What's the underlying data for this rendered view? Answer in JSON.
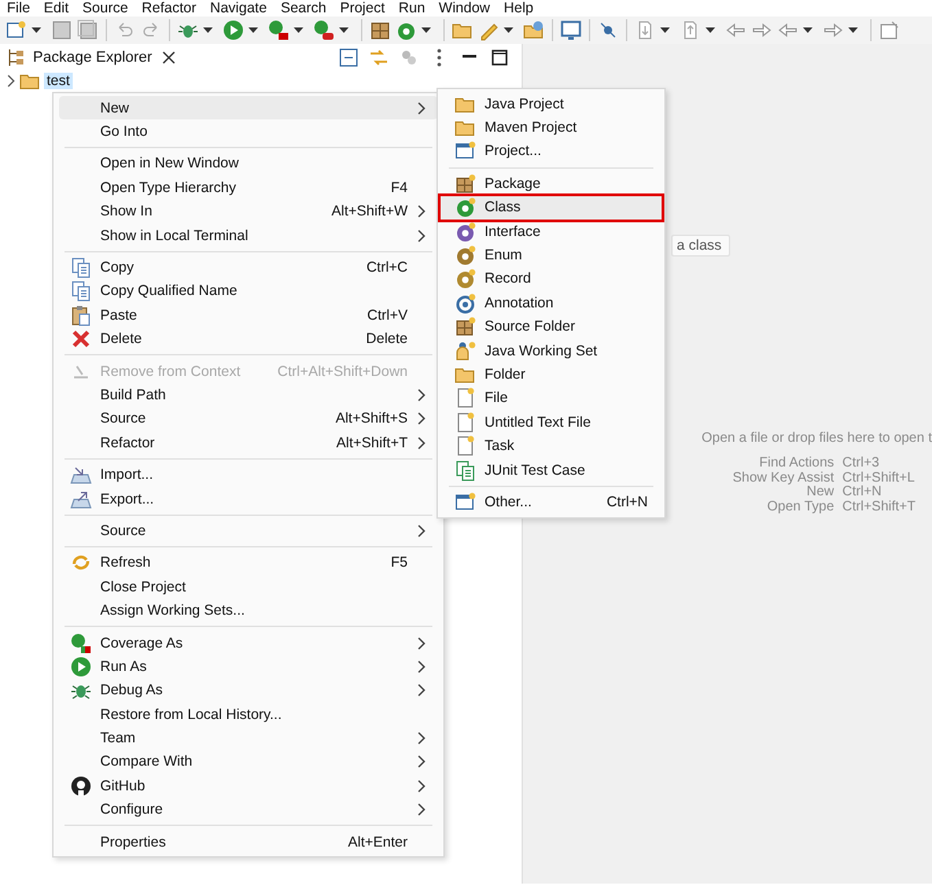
{
  "menubar": [
    "File",
    "Edit",
    "Source",
    "Refactor",
    "Navigate",
    "Search",
    "Project",
    "Run",
    "Window",
    "Help"
  ],
  "view_tab": {
    "title": "Package Explorer"
  },
  "tree": [
    {
      "label": "test",
      "selected": true,
      "expanded": false
    }
  ],
  "context_menu": [
    {
      "kind": "item",
      "label": "New",
      "selected": true,
      "disabled": false,
      "submenu": true
    },
    {
      "kind": "item",
      "label": "Go Into",
      "selected": false,
      "disabled": false,
      "submenu": false
    },
    {
      "kind": "separator"
    },
    {
      "kind": "item",
      "label": "Open in New Window",
      "selected": false,
      "disabled": false,
      "submenu": false
    },
    {
      "kind": "item",
      "label": "Open Type Hierarchy",
      "shortcut": "F4",
      "selected": false,
      "disabled": false,
      "submenu": false
    },
    {
      "kind": "item",
      "label": "Show In",
      "shortcut": "Alt+Shift+W",
      "selected": false,
      "disabled": false,
      "submenu": true
    },
    {
      "kind": "item",
      "label": "Show in Local Terminal",
      "selected": false,
      "disabled": false,
      "submenu": true
    },
    {
      "kind": "separator"
    },
    {
      "kind": "item",
      "label": "Copy",
      "shortcut": "Ctrl+C",
      "selected": false,
      "disabled": false,
      "submenu": false
    },
    {
      "kind": "item",
      "label": "Copy Qualified Name",
      "selected": false,
      "disabled": false,
      "submenu": false
    },
    {
      "kind": "item",
      "label": "Paste",
      "shortcut": "Ctrl+V",
      "selected": false,
      "disabled": false,
      "submenu": false
    },
    {
      "kind": "item",
      "label": "Delete",
      "shortcut": "Delete",
      "selected": false,
      "disabled": false,
      "submenu": false
    },
    {
      "kind": "separator"
    },
    {
      "kind": "item",
      "label": "Remove from Context",
      "shortcut": "Ctrl+Alt+Shift+Down",
      "selected": false,
      "disabled": true,
      "submenu": false
    },
    {
      "kind": "item",
      "label": "Build Path",
      "selected": false,
      "disabled": false,
      "submenu": true
    },
    {
      "kind": "item",
      "label": "Source",
      "shortcut": "Alt+Shift+S",
      "selected": false,
      "disabled": false,
      "submenu": true
    },
    {
      "kind": "item",
      "label": "Refactor",
      "shortcut": "Alt+Shift+T",
      "selected": false,
      "disabled": false,
      "submenu": true
    },
    {
      "kind": "separator"
    },
    {
      "kind": "item",
      "label": "Import...",
      "selected": false,
      "disabled": false,
      "submenu": false
    },
    {
      "kind": "item",
      "label": "Export...",
      "selected": false,
      "disabled": false,
      "submenu": false
    },
    {
      "kind": "separator"
    },
    {
      "kind": "item",
      "label": "Source",
      "selected": false,
      "disabled": false,
      "submenu": true
    },
    {
      "kind": "separator"
    },
    {
      "kind": "item",
      "label": "Refresh",
      "shortcut": "F5",
      "selected": false,
      "disabled": false,
      "submenu": false
    },
    {
      "kind": "item",
      "label": "Close Project",
      "selected": false,
      "disabled": false,
      "submenu": false
    },
    {
      "kind": "item",
      "label": "Assign Working Sets...",
      "selected": false,
      "disabled": false,
      "submenu": false
    },
    {
      "kind": "separator"
    },
    {
      "kind": "item",
      "label": "Coverage As",
      "selected": false,
      "disabled": false,
      "submenu": true
    },
    {
      "kind": "item",
      "label": "Run As",
      "selected": false,
      "disabled": false,
      "submenu": true
    },
    {
      "kind": "item",
      "label": "Debug As",
      "selected": false,
      "disabled": false,
      "submenu": true
    },
    {
      "kind": "item",
      "label": "Restore from Local History...",
      "selected": false,
      "disabled": false,
      "submenu": false
    },
    {
      "kind": "item",
      "label": "Team",
      "selected": false,
      "disabled": false,
      "submenu": true
    },
    {
      "kind": "item",
      "label": "Compare With",
      "selected": false,
      "disabled": false,
      "submenu": true
    },
    {
      "kind": "item",
      "label": "GitHub",
      "selected": false,
      "disabled": false,
      "submenu": true
    },
    {
      "kind": "item",
      "label": "Configure",
      "selected": false,
      "disabled": false,
      "submenu": true
    },
    {
      "kind": "separator"
    },
    {
      "kind": "item",
      "label": "Properties",
      "shortcut": "Alt+Enter",
      "selected": false,
      "disabled": false,
      "submenu": false
    }
  ],
  "submenu": [
    {
      "kind": "item",
      "label": "Java Project",
      "selected": false,
      "outlined": false
    },
    {
      "kind": "item",
      "label": "Maven Project",
      "selected": false,
      "outlined": false
    },
    {
      "kind": "item",
      "label": "Project...",
      "selected": false,
      "outlined": false
    },
    {
      "kind": "separator"
    },
    {
      "kind": "item",
      "label": "Package",
      "selected": false,
      "outlined": false
    },
    {
      "kind": "item",
      "label": "Class",
      "selected": true,
      "outlined": true
    },
    {
      "kind": "item",
      "label": "Interface",
      "selected": false,
      "outlined": false
    },
    {
      "kind": "item",
      "label": "Enum",
      "selected": false,
      "outlined": false
    },
    {
      "kind": "item",
      "label": "Record",
      "selected": false,
      "outlined": false
    },
    {
      "kind": "item",
      "label": "Annotation",
      "selected": false,
      "outlined": false
    },
    {
      "kind": "item",
      "label": "Source Folder",
      "selected": false,
      "outlined": false
    },
    {
      "kind": "item",
      "label": "Java Working Set",
      "selected": false,
      "outlined": false
    },
    {
      "kind": "item",
      "label": "Folder",
      "selected": false,
      "outlined": false
    },
    {
      "kind": "item",
      "label": "File",
      "selected": false,
      "outlined": false
    },
    {
      "kind": "item",
      "label": "Untitled Text File",
      "selected": false,
      "outlined": false
    },
    {
      "kind": "item",
      "label": "Task",
      "selected": false,
      "outlined": false
    },
    {
      "kind": "item",
      "label": "JUnit Test Case",
      "selected": false,
      "outlined": false
    },
    {
      "kind": "separator"
    },
    {
      "kind": "item",
      "label": "Other...",
      "shortcut": "Ctrl+N",
      "selected": false,
      "outlined": false
    }
  ],
  "tooltip": "a class",
  "editor": {
    "hint": "Open a file or drop files here to open t",
    "keys": [
      {
        "action": "Find Actions",
        "shortcut": "Ctrl+3"
      },
      {
        "action": "Show Key Assist",
        "shortcut": "Ctrl+Shift+L"
      },
      {
        "action": "New",
        "shortcut": "Ctrl+N"
      },
      {
        "action": "Open Type",
        "shortcut": "Ctrl+Shift+T"
      }
    ]
  }
}
